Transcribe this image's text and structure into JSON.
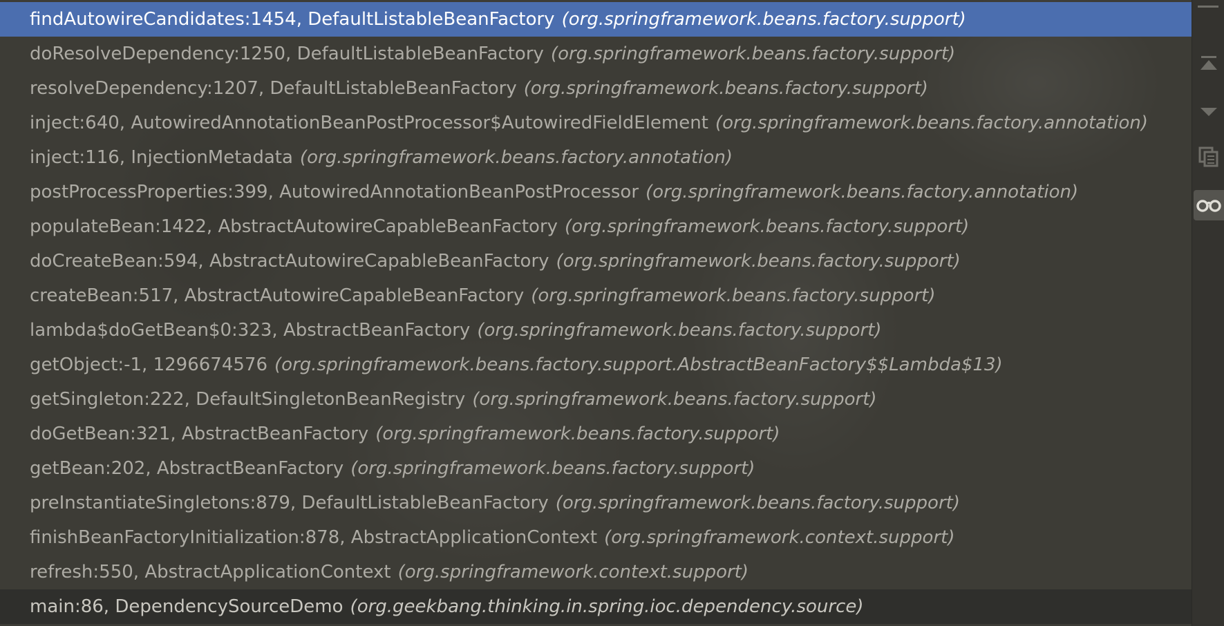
{
  "frames": [
    {
      "method": "findAutowireCandidates:1454, DefaultListableBeanFactory",
      "package": "(org.springframework.beans.factory.support)",
      "state": "selected"
    },
    {
      "method": "doResolveDependency:1250, DefaultListableBeanFactory",
      "package": "(org.springframework.beans.factory.support)"
    },
    {
      "method": "resolveDependency:1207, DefaultListableBeanFactory",
      "package": "(org.springframework.beans.factory.support)"
    },
    {
      "method": "inject:640, AutowiredAnnotationBeanPostProcessor$AutowiredFieldElement",
      "package": "(org.springframework.beans.factory.annotation)"
    },
    {
      "method": "inject:116, InjectionMetadata",
      "package": "(org.springframework.beans.factory.annotation)"
    },
    {
      "method": "postProcessProperties:399, AutowiredAnnotationBeanPostProcessor",
      "package": "(org.springframework.beans.factory.annotation)"
    },
    {
      "method": "populateBean:1422, AbstractAutowireCapableBeanFactory",
      "package": "(org.springframework.beans.factory.support)"
    },
    {
      "method": "doCreateBean:594, AbstractAutowireCapableBeanFactory",
      "package": "(org.springframework.beans.factory.support)"
    },
    {
      "method": "createBean:517, AbstractAutowireCapableBeanFactory",
      "package": "(org.springframework.beans.factory.support)"
    },
    {
      "method": "lambda$doGetBean$0:323, AbstractBeanFactory",
      "package": "(org.springframework.beans.factory.support)"
    },
    {
      "method": "getObject:-1, 1296674576",
      "package": "(org.springframework.beans.factory.support.AbstractBeanFactory$$Lambda$13)"
    },
    {
      "method": "getSingleton:222, DefaultSingletonBeanRegistry",
      "package": "(org.springframework.beans.factory.support)"
    },
    {
      "method": "doGetBean:321, AbstractBeanFactory",
      "package": "(org.springframework.beans.factory.support)"
    },
    {
      "method": "getBean:202, AbstractBeanFactory",
      "package": "(org.springframework.beans.factory.support)"
    },
    {
      "method": "preInstantiateSingletons:879, DefaultListableBeanFactory",
      "package": "(org.springframework.beans.factory.support)"
    },
    {
      "method": "finishBeanFactoryInitialization:878, AbstractApplicationContext",
      "package": "(org.springframework.context.support)"
    },
    {
      "method": "refresh:550, AbstractApplicationContext",
      "package": "(org.springframework.context.support)"
    },
    {
      "method": "main:86, DependencySourceDemo",
      "package": "(org.geekbang.thinking.in.spring.ioc.dependency.source)",
      "state": "bottom"
    }
  ],
  "sidebar": {
    "buttons": [
      {
        "name": "scroll-to-top-icon",
        "glyph": "▲"
      },
      {
        "name": "scroll-down-icon",
        "glyph": "▼"
      },
      {
        "name": "copy-stack-icon",
        "glyph": "❐"
      },
      {
        "name": "glasses-icon",
        "glyph": "oo",
        "active": true
      }
    ]
  },
  "colors": {
    "selected_row": "#4b6eaf",
    "text": "#adaba4",
    "background": "#3d3c36"
  }
}
